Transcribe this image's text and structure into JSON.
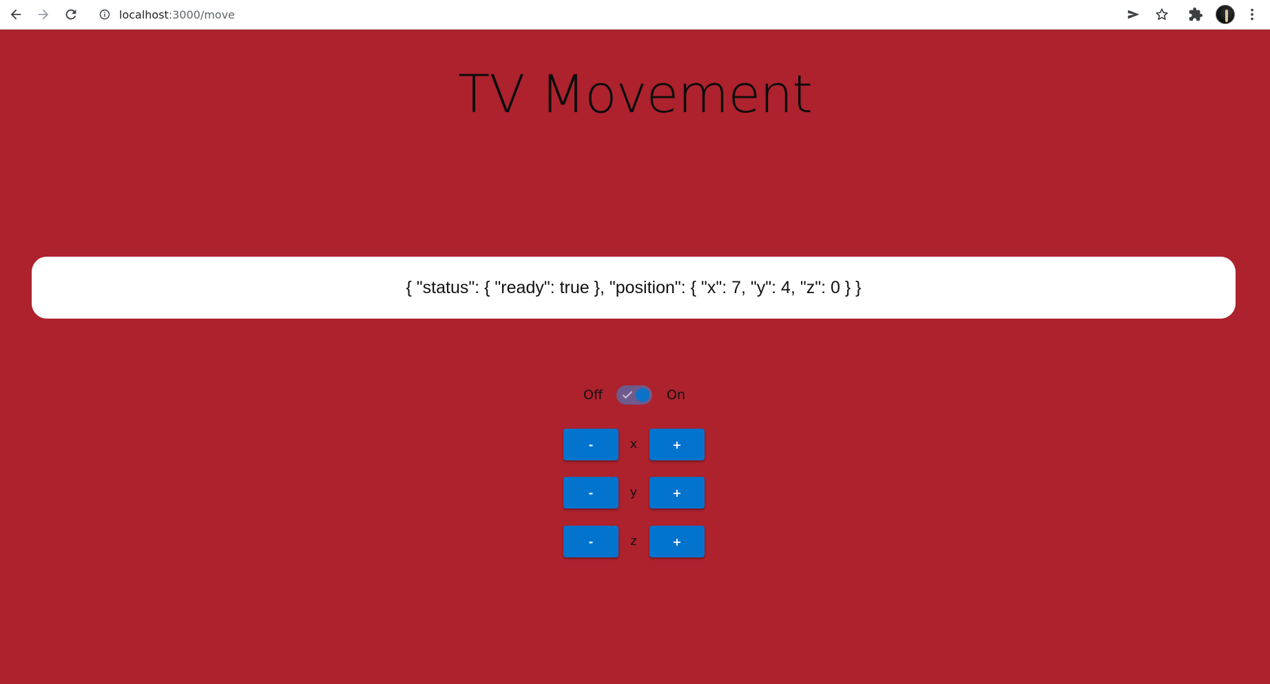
{
  "browser": {
    "url_host": "localhost",
    "url_path": ":3000/move"
  },
  "page": {
    "title": "TV Movement",
    "status_json": "{ \"status\": { \"ready\": true }, \"position\": { \"x\": 7, \"y\": 4, \"z\": 0 } }"
  },
  "toggle": {
    "off_label": "Off",
    "on_label": "On",
    "state": "on"
  },
  "axes": [
    {
      "name": "x",
      "minus_label": "-",
      "plus_label": "+"
    },
    {
      "name": "y",
      "minus_label": "-",
      "plus_label": "+"
    },
    {
      "name": "z",
      "minus_label": "-",
      "plus_label": "+"
    }
  ],
  "colors": {
    "background": "#ad222d",
    "button": "#0374ce",
    "switch_track": "#6e5a8c",
    "switch_knob": "#0a73c8"
  }
}
